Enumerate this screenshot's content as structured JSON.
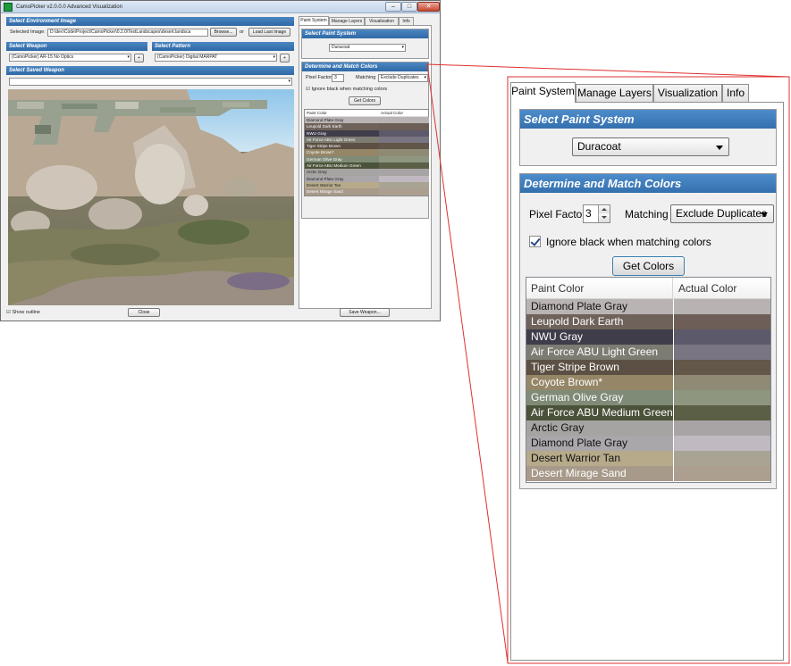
{
  "window": {
    "title": "CamoPicker   v2.0.0.0   Advanced Visualization",
    "caption_min": "–",
    "caption_max": "□",
    "caption_close": "✕"
  },
  "environment": {
    "header": "Select Environment Image",
    "selected_label": "Selected Image:",
    "path": "D:\\dev\\Code\\Project\\CamoPicker\\0.2.0\\TestLandscapes\\desert.landsca",
    "browse": "Browse...",
    "or": "or",
    "load_last": "Load Last Image"
  },
  "weapon": {
    "header": "Select Weapon",
    "value": "(CamoPicker) AR-15 No Optics",
    "add": "+"
  },
  "pattern": {
    "header": "Select Pattern",
    "value": "(CamoPicker) Digital MARPAT",
    "add": "+"
  },
  "saved": {
    "header": "Select Saved Weapon",
    "value": ""
  },
  "footer": {
    "show_outline": "Show outline",
    "close": "Close",
    "save_weapon": "Save Weapon..."
  },
  "tabs": [
    {
      "label": "Paint System",
      "active": true
    },
    {
      "label": "Manage Layers",
      "active": false
    },
    {
      "label": "Visualization",
      "active": false
    },
    {
      "label": "Info",
      "active": false
    }
  ],
  "paint_system": {
    "header": "Select Paint System",
    "value": "Duracoat"
  },
  "match": {
    "header": "Determine and Match Colors",
    "pixel_factor_label": "Pixel Factor",
    "pixel_factor": "3",
    "matching_label": "Matching",
    "matching_value": "Exclude Duplicates",
    "ignore_black_label": "Ignore black when matching colors",
    "get_colors": "Get Colors",
    "col_paint": "Paint Color",
    "col_actual": "Actual Color"
  },
  "colors": [
    {
      "name": "Diamond Plate Gray",
      "paint": "#b9b4b3",
      "actual": "#b8b3b2",
      "dark_text": true
    },
    {
      "name": "Leupold Dark Earth",
      "paint": "#6e625a",
      "actual": "#6d5f57",
      "dark_text": false
    },
    {
      "name": "NWU Gray",
      "paint": "#3f3d4a",
      "actual": "#5c596a",
      "dark_text": false
    },
    {
      "name": "Air Force ABU Light Green",
      "paint": "#7d7c72",
      "actual": "#7a7582",
      "dark_text": false
    },
    {
      "name": "Tiger Stripe Brown",
      "paint": "#5c5044",
      "actual": "#625749",
      "dark_text": false
    },
    {
      "name": "Coyote Brown*",
      "paint": "#958667",
      "actual": "#8f8a73",
      "dark_text": false
    },
    {
      "name": "German Olive Gray",
      "paint": "#7f8a77",
      "actual": "#8e9680",
      "dark_text": false
    },
    {
      "name": "Air Force ABU Medium Green",
      "paint": "#4a5239",
      "actual": "#5a5f46",
      "dark_text": false
    },
    {
      "name": "Arctic Gray",
      "paint": "#a5a4a2",
      "actual": "#a8a4a6",
      "dark_text": true
    },
    {
      "name": "Diamond Plate Gray",
      "paint": "#aaa7aa",
      "actual": "#c1b9c1",
      "dark_text": true
    },
    {
      "name": "Desert Warrior Tan",
      "paint": "#b6aa8a",
      "actual": "#a9a393",
      "dark_text": true
    },
    {
      "name": "Desert Mirage Sand",
      "paint": "#a79a8a",
      "actual": "#ad9f90",
      "dark_text": false
    }
  ]
}
